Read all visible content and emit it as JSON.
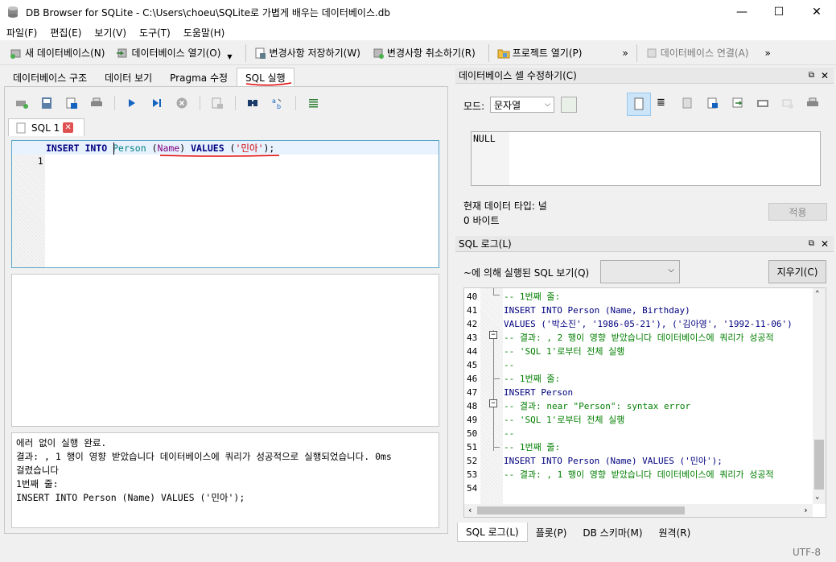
{
  "window": {
    "title": "DB Browser for SQLite - C:\\Users\\choeu\\SQLite로 가볍게 배우는 데이터베이스.db",
    "minimize": "—",
    "maximize": "☐",
    "close": "✕"
  },
  "menu": [
    "파일(F)",
    "편집(E)",
    "보기(V)",
    "도구(T)",
    "도움말(H)"
  ],
  "toolbar": {
    "new_db": "새 데이터베이스(N)",
    "open_db": "데이터베이스 열기(O)",
    "write_changes": "변경사항 저장하기(W)",
    "revert_changes": "변경사항 취소하기(R)",
    "open_project": "프로젝트 열기(P)",
    "attach_db": "데이터베이스 연결(A)",
    "more": "»"
  },
  "left_tabs": [
    "데이터베이스 구조",
    "데이터 보기",
    "Pragma 수정",
    "SQL 실행"
  ],
  "sql_tab": {
    "label": "SQL 1"
  },
  "editor": {
    "line_no": "1",
    "code_kw1": "INSERT INTO",
    "code_table": "Person",
    "code_col": "Name",
    "code_kw2": "VALUES",
    "code_str": "'민아'"
  },
  "result_message": {
    "line1": "에러 없이 실행 완료.",
    "line2": "결과: , 1 행이 영향 받았습니다 데이터베이스에 쿼리가 성공적으로 실행되었습니다. 0ms",
    "line3": "걸렸습니다",
    "line4": "1번째 줄:",
    "line5": "INSERT INTO Person (Name) VALUES ('민아');"
  },
  "cell_editor": {
    "title": "데이터베이스 셀 수정하기(C)",
    "mode_label": "모드:",
    "mode_value": "문자열",
    "content": "NULL",
    "type_label": "현재 데이터 타입: 널",
    "size_label": "0 바이트",
    "apply": "적용"
  },
  "sql_log": {
    "title": "SQL 로그(L)",
    "submitted_label": "~에 의해 실행된 SQL 보기(Q)",
    "clear": "지우기(C)",
    "lines": [
      {
        "no": "40",
        "text": "-- 1번째 줄:"
      },
      {
        "no": "41",
        "text": "INSERT INTO Person (Name, Birthday)"
      },
      {
        "no": "42",
        "text": "VALUES ('박소진', '1986-05-21'), ('김아영', '1992-11-06')"
      },
      {
        "no": "43",
        "text": "-- 결과: , 2 행이 영향 받았습니다 데이터베이스에 쿼리가 성공적"
      },
      {
        "no": "44",
        "text": "-- 'SQL 1'로부터 전체 실행"
      },
      {
        "no": "45",
        "text": "--"
      },
      {
        "no": "46",
        "text": "-- 1번째 줄:"
      },
      {
        "no": "47",
        "text": "INSERT Person"
      },
      {
        "no": "48",
        "text": "-- 결과: near \"Person\": syntax error"
      },
      {
        "no": "49",
        "text": "-- 'SQL 1'로부터 전체 실행"
      },
      {
        "no": "50",
        "text": "--"
      },
      {
        "no": "51",
        "text": "-- 1번째 줄:"
      },
      {
        "no": "52",
        "text": "INSERT INTO Person (Name) VALUES ('민아');"
      },
      {
        "no": "53",
        "text": "-- 결과: , 1 행이 영향 받았습니다 데이터베이스에 쿼리가 성공적"
      },
      {
        "no": "54",
        "text": ""
      }
    ]
  },
  "bottom_tabs": [
    "SQL 로그(L)",
    "플롯(P)",
    "DB 스키마(M)",
    "원격(R)"
  ],
  "status": {
    "encoding": "UTF-8"
  },
  "colors": {
    "accent": "#0078d7",
    "underline": "#e00000"
  }
}
